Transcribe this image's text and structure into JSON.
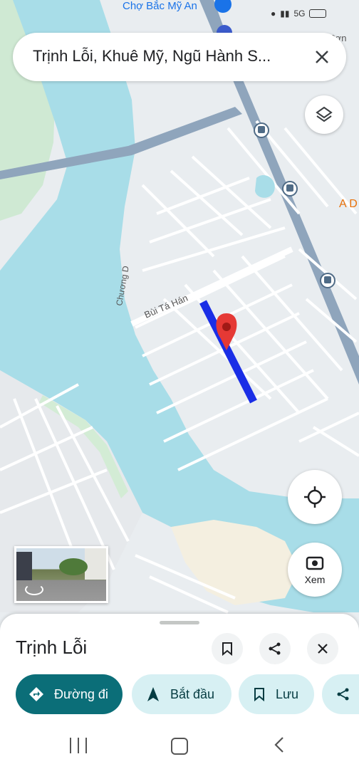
{
  "status_bar": {
    "poi_label": "Chợ Bắc Mỹ An",
    "battery": "5G"
  },
  "search": {
    "query": "Trịnh Lỗi, Khuê Mỹ, Ngũ Hành S..."
  },
  "map": {
    "street_labels": [
      "Bùi Tá Hán",
      "Chương D"
    ],
    "edge_labels": [
      "A D",
      "Sơn"
    ],
    "route_color": "#1a2ee6",
    "marker_color": "#e53935"
  },
  "street_view": {
    "label": "street-view-thumbnail"
  },
  "view_button": {
    "label": "Xem"
  },
  "sheet": {
    "title": "Trịnh Lỗi",
    "chips": {
      "directions": "Đường đi",
      "start": "Bắt đầu",
      "save": "Lưu"
    }
  },
  "colors": {
    "accent": "#0b6e78",
    "chip_bg": "#d7f0f3",
    "water": "#a8dde8",
    "land": "#e9edf0"
  }
}
